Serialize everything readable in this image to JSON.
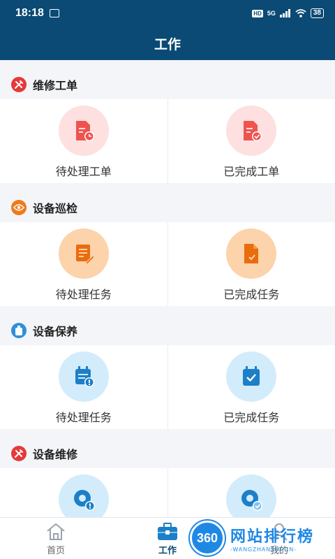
{
  "status_bar": {
    "time": "18:18",
    "hd": "HD",
    "network": "5G",
    "battery": "38"
  },
  "header": {
    "title": "工作"
  },
  "sections": [
    {
      "title": "维修工单",
      "icon": "wrench-hammer-icon",
      "color": "#e5393b",
      "items": [
        {
          "label": "待处理工单",
          "icon": "document-clock-icon",
          "bg": "#fde0df",
          "fg": "#ef5350"
        },
        {
          "label": "已完成工单",
          "icon": "document-check-icon",
          "bg": "#fde0df",
          "fg": "#ef5350"
        }
      ]
    },
    {
      "title": "设备巡检",
      "icon": "eye-icon",
      "color": "#ef7a1a",
      "items": [
        {
          "label": "待处理任务",
          "icon": "note-edit-icon",
          "bg": "#fcd3ab",
          "fg": "#ea6c0e"
        },
        {
          "label": "已完成任务",
          "icon": "file-check-icon",
          "bg": "#fcd3ab",
          "fg": "#ea6c0e"
        }
      ]
    },
    {
      "title": "设备保养",
      "icon": "bottle-icon",
      "color": "#2f8fd8",
      "items": [
        {
          "label": "待处理任务",
          "icon": "calendar-alert-icon",
          "bg": "#d3ecfb",
          "fg": "#1d7fc7"
        },
        {
          "label": "已完成任务",
          "icon": "calendar-check-icon",
          "bg": "#d3ecfb",
          "fg": "#1d7fc7"
        }
      ]
    },
    {
      "title": "设备维修",
      "icon": "wrench-hammer-icon",
      "color": "#e5393b",
      "items": [
        {
          "label": "",
          "icon": "gear-alert-icon",
          "bg": "#d3ecfb",
          "fg": "#1d7fc7"
        },
        {
          "label": "",
          "icon": "gear-check-icon",
          "bg": "#d3ecfb",
          "fg": "#1d7fc7"
        }
      ]
    }
  ],
  "nav": [
    {
      "label": "首页",
      "icon": "home-icon",
      "active": false
    },
    {
      "label": "工作",
      "icon": "briefcase-icon",
      "active": true
    },
    {
      "label": "我的",
      "icon": "user-icon",
      "active": false
    }
  ],
  "watermark": {
    "logo": "360",
    "title": "网站排行榜",
    "url": "-WANGZHAN360.CN-"
  }
}
